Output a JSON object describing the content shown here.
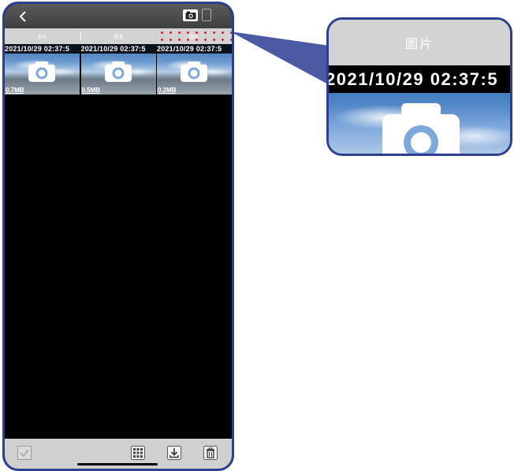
{
  "tabs": [
    {
      "label": "影片"
    },
    {
      "label": "緊急"
    },
    {
      "label": "圖片"
    }
  ],
  "thumbnails": [
    {
      "date": "2021/10/29 02:37:5",
      "size": "0.7MB"
    },
    {
      "date": "2021/10/29 02:37:5",
      "size": "0.5MB"
    },
    {
      "date": "2021/10/29 02:37:5",
      "size": "0.2MB"
    }
  ],
  "zoom": {
    "tab_label": "圖片",
    "date": "2021/10/29 02:37:5"
  },
  "icons": {
    "back": "chevron-left-icon",
    "camera": "camera-icon",
    "phone": "phone-icon",
    "select": "check-icon",
    "grid": "grid-icon",
    "download": "download-icon",
    "delete": "trash-icon"
  },
  "colors": {
    "frame": "#2e3f8f",
    "active_tab_dots": "#e01f3c",
    "tab_bar": "#d3d3d3",
    "bottom_bar": "#d0d0d0"
  }
}
